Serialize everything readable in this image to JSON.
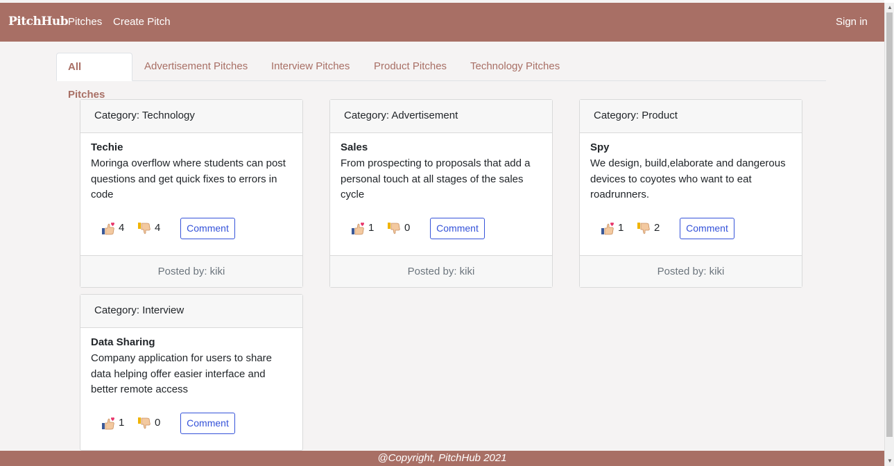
{
  "navbar": {
    "brand": "PitchHub",
    "links": [
      "Pitches",
      "Create Pitch"
    ],
    "signin": "Sign in",
    "color": "#a86f65"
  },
  "tabs": [
    {
      "label": "All Pitches",
      "active": true
    },
    {
      "label": "Advertisement Pitches",
      "active": false
    },
    {
      "label": "Interview Pitches",
      "active": false
    },
    {
      "label": "Product Pitches",
      "active": false
    },
    {
      "label": "Technology Pitches",
      "active": false
    }
  ],
  "pitches": [
    {
      "category": "Category: Technology",
      "title": "Techie",
      "text": "Moringa overflow where students can post questions and get quick fixes to errors in code",
      "likes": "4",
      "dislikes": "4",
      "comment": "Comment",
      "posted_by": "Posted by: kiki"
    },
    {
      "category": "Category: Advertisement",
      "title": "Sales",
      "text": "From prospecting to proposals that add a personal touch at all stages of the sales cycle",
      "likes": "1",
      "dislikes": "0",
      "comment": "Comment",
      "posted_by": "Posted by: kiki"
    },
    {
      "category": "Category: Product",
      "title": "Spy",
      "text": "We design, build,elaborate and dangerous devices to coyotes who want to eat roadrunners.",
      "likes": "1",
      "dislikes": "2",
      "comment": "Comment",
      "posted_by": "Posted by: kiki"
    },
    {
      "category": "Category: Interview",
      "title": "Data Sharing",
      "text": "Company application for users to share data helping offer easier interface and better remote access",
      "likes": "1",
      "dislikes": "0",
      "comment": "Comment",
      "posted_by": ""
    }
  ],
  "icons": {
    "like": "thumbs-up-icon",
    "dislike": "thumbs-down-icon"
  },
  "footer": {
    "text": "@Copyright, PitchHub 2021"
  },
  "colors": {
    "accent": "#a86f65",
    "button": "#3452d9",
    "background": "#f5f3f3"
  }
}
